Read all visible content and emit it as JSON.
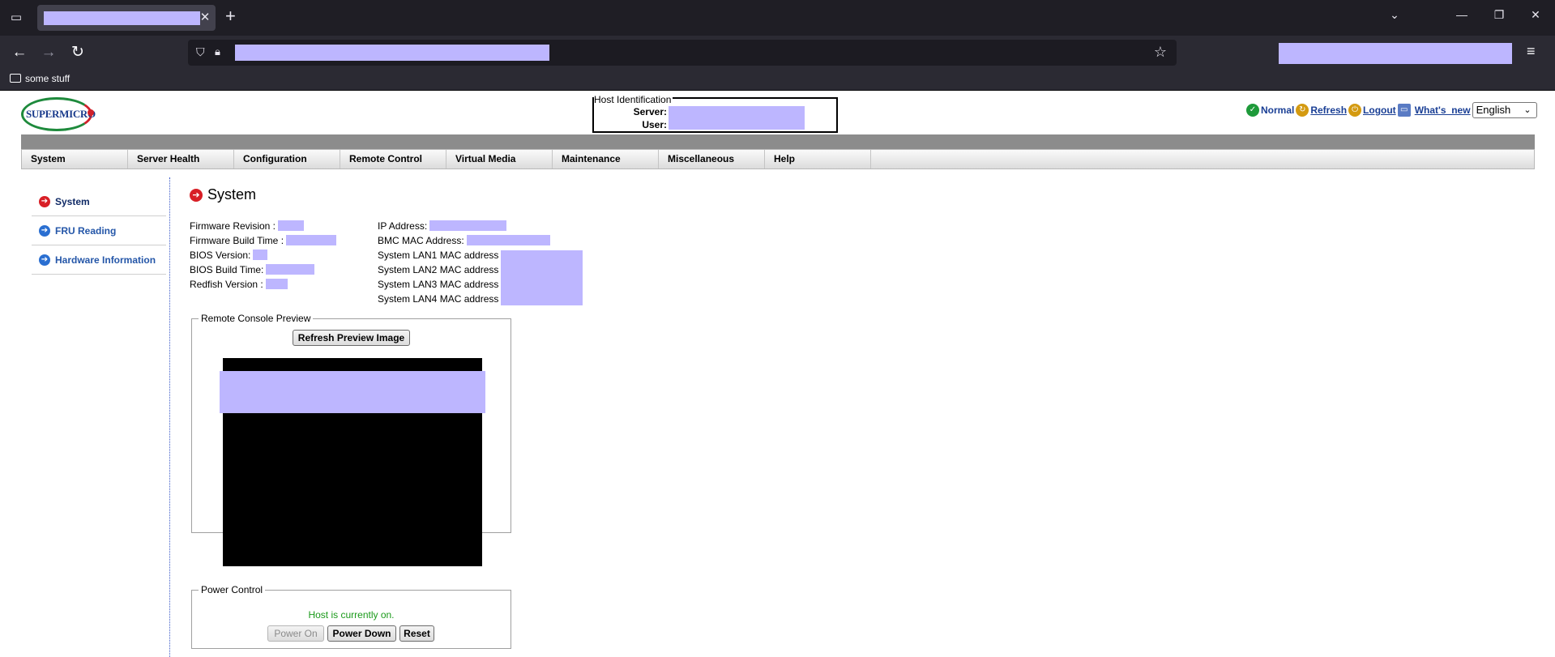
{
  "browser": {
    "tab_list_icon": "tab-list-icon",
    "tab_close_glyph": "✕",
    "new_tab_glyph": "+",
    "bookmarks": [
      {
        "label": "some stuff",
        "icon": "folder-icon"
      }
    ]
  },
  "header": {
    "logo_text": "SUPERMICRO",
    "host_identification": {
      "legend": "Host Identification",
      "server_label": "Server:",
      "user_label": "User:"
    },
    "status": {
      "label": "Normal",
      "icon": "check-circle-icon",
      "color": "#1e9a3a"
    },
    "links": [
      {
        "label": "Refresh",
        "icon": "refresh-icon"
      },
      {
        "label": "Logout",
        "icon": "logout-icon"
      },
      {
        "label": "What's_new",
        "icon": "monitor-icon"
      }
    ],
    "language": {
      "selected": "English"
    }
  },
  "menu": {
    "items": [
      "System",
      "Server Health",
      "Configuration",
      "Remote Control",
      "Virtual Media",
      "Maintenance",
      "Miscellaneous",
      "Help"
    ]
  },
  "sidebar": {
    "items": [
      {
        "label": "System",
        "active": true,
        "color": "#d81f26"
      },
      {
        "label": "FRU Reading",
        "active": false,
        "color": "#2a6fd1"
      },
      {
        "label": "Hardware Information",
        "active": false,
        "color": "#2a6fd1"
      }
    ]
  },
  "main": {
    "title": "System",
    "left_info": [
      "Firmware Revision :",
      "Firmware Build Time :",
      "BIOS Version:",
      "BIOS Build Time:",
      "Redfish Version :"
    ],
    "right_info": [
      "IP Address:",
      "BMC MAC Address:",
      "System LAN1 MAC address",
      "System LAN2 MAC address",
      "System LAN3 MAC address",
      "System LAN4 MAC address"
    ],
    "remote_console": {
      "legend": "Remote Console Preview",
      "refresh_button": "Refresh Preview Image"
    },
    "power_control": {
      "legend": "Power Control",
      "status": "Host is currently on.",
      "status_color": "#1a9a1a",
      "buttons": {
        "power_on": "Power On",
        "power_down": "Power Down",
        "reset": "Reset"
      }
    }
  }
}
